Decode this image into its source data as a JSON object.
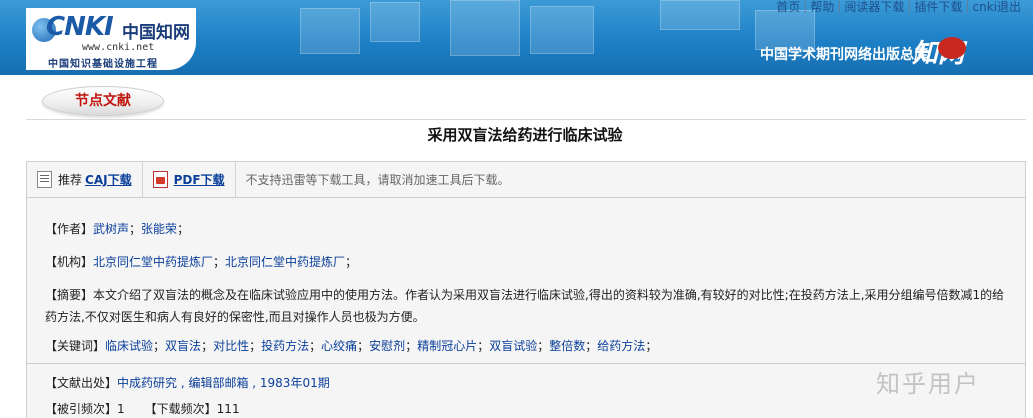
{
  "top_links": [
    "首页",
    "帮助",
    "阅读器下载",
    "插件下载",
    "cnki退出"
  ],
  "logo": {
    "cnki": "CNKI",
    "cn_name": "中国知网",
    "url": "www.cnki.net",
    "sub": "中国知识基础设施工程"
  },
  "publisher": "中国学术期刊网络出版总库",
  "zw_logo": "知网",
  "node_tab": "节点文献",
  "title": "采用双盲法给药进行临床试验",
  "download": {
    "caj_prefix": "推荐",
    "caj_label": "CAJ下载",
    "pdf_label": "PDF下载",
    "note": "不支持迅雷等下载工具，请取消加速工具后下载。"
  },
  "author": {
    "key": "【作者】",
    "names": [
      "武树声",
      "张能荣"
    ]
  },
  "org": {
    "key": "【机构】",
    "names": [
      "北京同仁堂中药提炼厂",
      "北京同仁堂中药提炼厂"
    ]
  },
  "abstract": {
    "key": "【摘要】",
    "text": "本文介绍了双盲法的概念及在临床试验应用中的使用方法。作者认为采用双盲法进行临床试验,得出的资料较为准确,有较好的对比性;在投药方法上,采用分组编号倍数减1的给药方法,不仅对医生和病人有良好的保密性,而且对操作人员也极为方便。"
  },
  "keywords": {
    "key": "【关键词】",
    "items": [
      "临床试验",
      "双盲法",
      "对比性",
      "投药方法",
      "心绞痛",
      "安慰剂",
      "精制冠心片",
      "双盲试验",
      "整倍数",
      "给药方法"
    ]
  },
  "source": {
    "key": "【文献出处】",
    "value": "中成药研究 , 编辑部邮箱 , 1983年01期"
  },
  "citation": {
    "cited_key": "【被引频次】",
    "cited_value": "1",
    "download_key": "【下载频次】",
    "download_value": "111"
  },
  "watermark": "知乎用户"
}
